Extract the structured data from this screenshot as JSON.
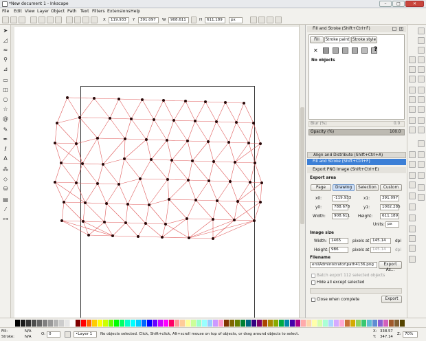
{
  "window": {
    "title": "*New document 1 - Inkscape",
    "min": "–",
    "max": "□",
    "close": "✕"
  },
  "menu": [
    "File",
    "Edit",
    "View",
    "Layer",
    "Object",
    "Path",
    "Text",
    "Filters",
    "Extensions",
    "Help"
  ],
  "toolbar": {
    "x_label": "X",
    "x": "119.933",
    "y_label": "Y",
    "y": "391.097",
    "w_label": "W",
    "w": "908.611",
    "h_label": "H",
    "h": "611.189",
    "unit": "px"
  },
  "fill_stroke": {
    "title": "Fill and Stroke (Shift+Ctrl+F)",
    "tabs": [
      "Fill",
      "Stroke paint",
      "Stroke style"
    ],
    "no_objects": "No objects",
    "blur_label": "Blur (%)",
    "blur_value": "0.0",
    "opacity_label": "Opacity (%)",
    "opacity_value": "100.0"
  },
  "docked": {
    "align": "Align and Distribute (Shift+Ctrl+A)",
    "fill_stroke": "Fill and Stroke (Shift+Ctrl+F)"
  },
  "export": {
    "title": "Export PNG Image (Shift+Ctrl+E)",
    "area_heading": "Export area",
    "area_buttons": [
      "Page",
      "Drawing",
      "Selection",
      "Custom"
    ],
    "x0_label": "x0:",
    "x0": "-119.933",
    "x1_label": "x1:",
    "x1": "391.097",
    "y0_label": "y0:",
    "y0": "788.678",
    "y1_label": "y1:",
    "y1": "1002.285",
    "width_label": "Width:",
    "width": "908.611",
    "height_label": "Height:",
    "height": "611.189",
    "units_label": "Units:",
    "units": "px",
    "size_heading": "Image size",
    "img_width_label": "Width:",
    "img_width": "1465",
    "img_height_label": "Height:",
    "img_height": "986",
    "pixels_at": "pixels at",
    "dpi_value": "145.14",
    "dpi_value2": "145.14",
    "dpi_unit": "dpi",
    "filename_heading": "Filename",
    "filename": "ers\\Administrator\\path4136.png",
    "export_as": "Export As...",
    "batch": "Batch export 112 selected objects",
    "hide_all": "Hide all except selected",
    "close_when": "Close when complete",
    "export_btn": "Export"
  },
  "status": {
    "fill_label": "Fill:",
    "fill_value": "N/A",
    "stroke_label": "Stroke:",
    "stroke_value": "N/A",
    "o_label": "O:",
    "o_value": "0",
    "layer": "•Layer 1",
    "message": "No objects selected. Click, Shift+click, Alt+scroll mouse on top of objects, or drag around objects to select.",
    "x_label": "X:",
    "x": "338.57",
    "y_label": "Y:",
    "y": "347.14",
    "z_label": "Z:",
    "zoom": "70%"
  },
  "colors": {
    "mesh_line": "#e05a5a",
    "mesh_node": "#2a0a0a",
    "accent": "#3c7fd6"
  },
  "palette": [
    "#000000",
    "#1a1a1a",
    "#333333",
    "#4d4d4d",
    "#666666",
    "#808080",
    "#999999",
    "#b3b3b3",
    "#cccccc",
    "#e6e6e6",
    "#ffffff",
    "#800000",
    "#ff0000",
    "#ff6600",
    "#ffcc00",
    "#ffff00",
    "#ccff00",
    "#66ff00",
    "#00ff00",
    "#00ff66",
    "#00ffcc",
    "#00ffff",
    "#00ccff",
    "#0066ff",
    "#0000ff",
    "#6600ff",
    "#cc00ff",
    "#ff00ff",
    "#ff0066",
    "#ff9999",
    "#ffcc99",
    "#ffff99",
    "#ccff99",
    "#99ffcc",
    "#99ffff",
    "#99ccff",
    "#cc99ff",
    "#ff99cc",
    "#803300",
    "#806600",
    "#668000",
    "#008033",
    "#006680",
    "#330080",
    "#800066",
    "#aa4400",
    "#aa8800",
    "#88aa00",
    "#00aa44",
    "#0088aa",
    "#4400aa",
    "#aa0088",
    "#ffaaaa",
    "#ffd5aa",
    "#ffffaa",
    "#d5ffaa",
    "#aaffd5",
    "#aad5ff",
    "#d5aaff",
    "#ffaad5",
    "#c87137",
    "#d4aa00",
    "#8dd35f",
    "#37c871",
    "#5fbcd3",
    "#5f8dd3",
    "#8d5fd3",
    "#d35fbc",
    "#a05a2c",
    "#806033",
    "#554400"
  ]
}
